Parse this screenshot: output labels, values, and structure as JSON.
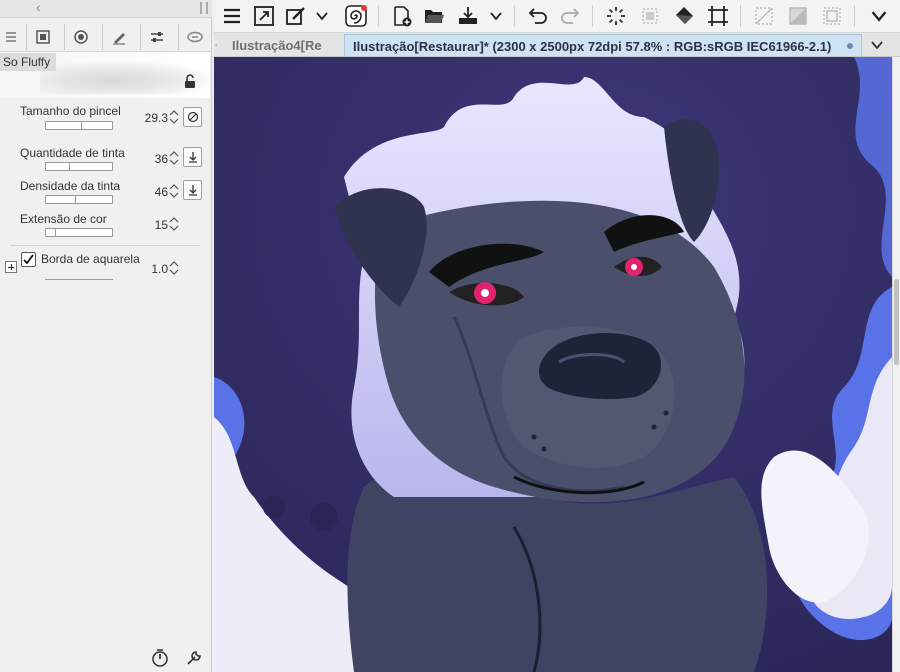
{
  "sub_tool": {
    "brush_name": "So Fluffy",
    "properties": [
      {
        "label": "Tamanho do pincel",
        "value": "29.3",
        "level": 0.55,
        "button": "size-dynamics"
      },
      {
        "label": "Quantidade de tinta",
        "value": "36",
        "level": 0.36,
        "button": "ink-amount-dynamics"
      },
      {
        "label": "Densidade da tinta",
        "value": "46",
        "level": 0.46,
        "button": "ink-density-dynamics"
      },
      {
        "label": "Extensão de cor",
        "value": "15",
        "level": 0.15,
        "button": ""
      }
    ],
    "watercolor": {
      "label": "Borda de aquarela",
      "value": "1.0",
      "checked": true
    }
  },
  "toolbar": {
    "icons": [
      "menu-icon",
      "expand-icon",
      "transform-icon",
      "chevron-down-icon",
      "spiral-logo-icon",
      "new-file-icon",
      "open-folder-icon",
      "save-download-icon",
      "chevron-down-icon",
      "undo-icon",
      "redo-icon",
      "loading-spinner-icon",
      "selection-icon",
      "fill-bucket-icon",
      "crop-icon",
      "deselect-icon",
      "invert-selection-icon",
      "frame-icon",
      "chevron-down-icon"
    ]
  },
  "tabs": {
    "inactive": "Ilustração4[Re",
    "active": "Ilustração[Restaurar]* (2300 x 2500px 72dpi 57.8% : RGB:sRGB IEC61966-2.1)"
  },
  "colors": {
    "canvas_bg": "#322d61",
    "active_tab": "#cfe2f3",
    "flame_blue": "#5a72e8",
    "eye_pink": "#e0226f"
  }
}
